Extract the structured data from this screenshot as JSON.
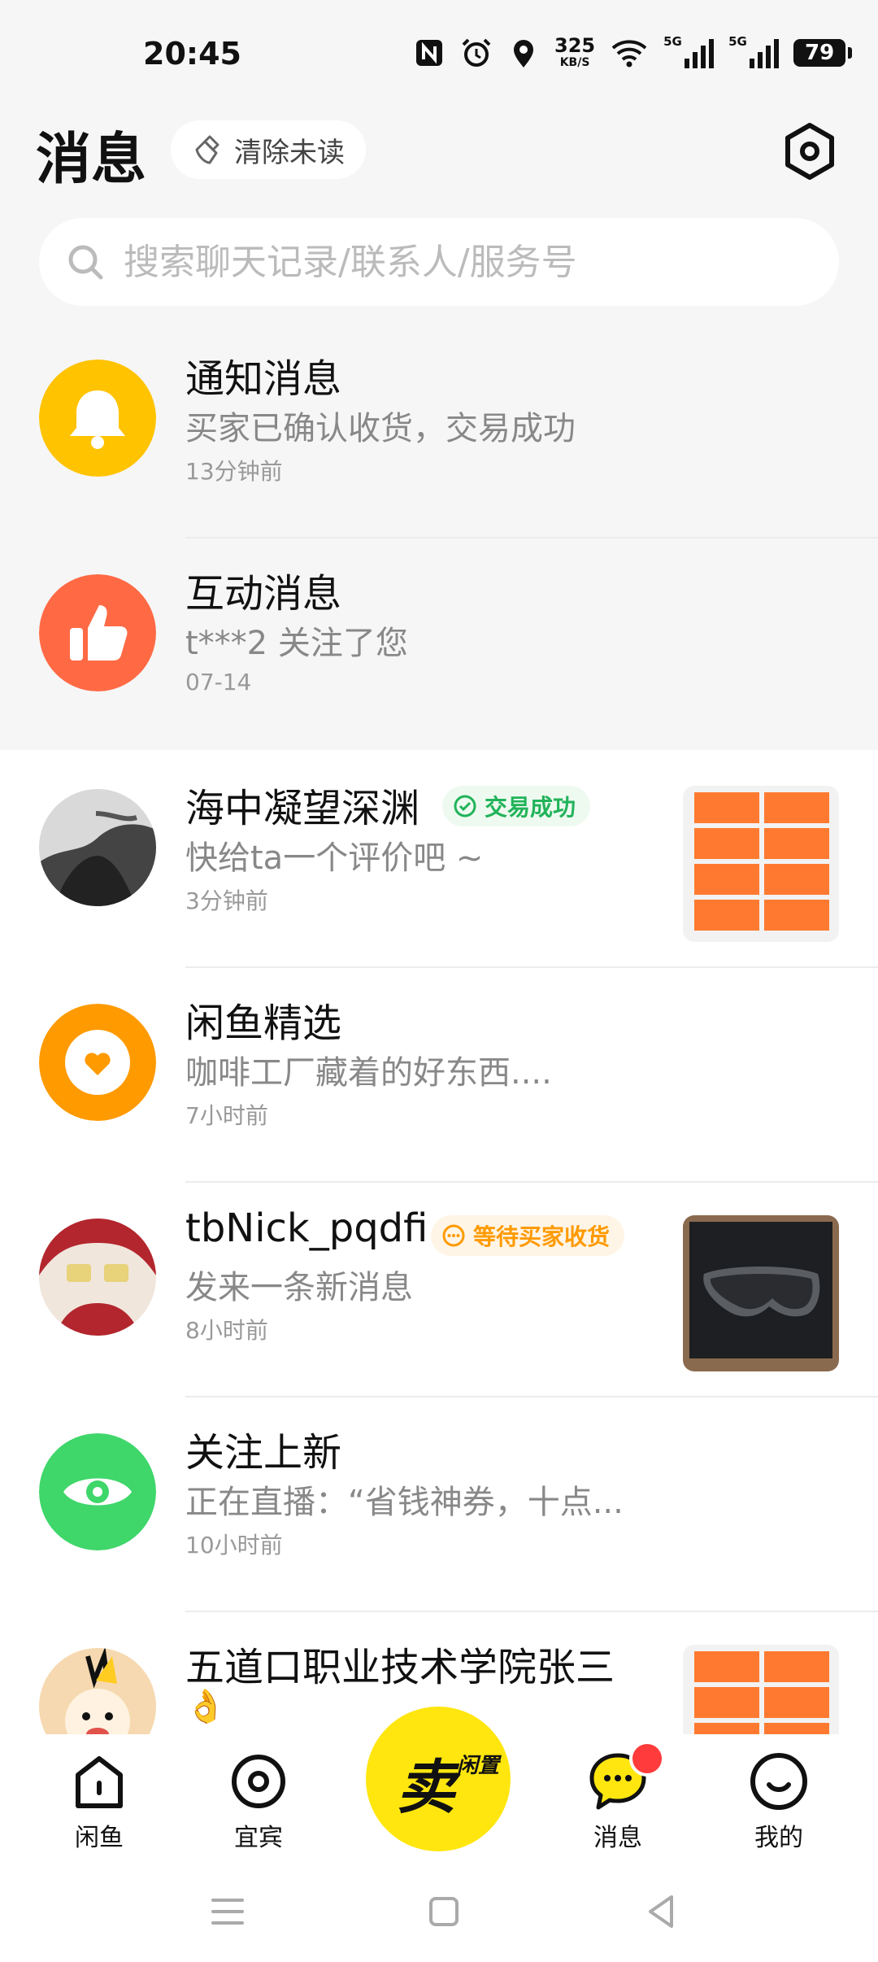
{
  "status_bar": {
    "time": "20:45",
    "net_speed_value": "325",
    "net_speed_unit": "KB/S",
    "signal_1": "5G",
    "signal_2": "5G",
    "battery": "79",
    "icons": [
      "nfc-icon",
      "alarm-icon",
      "location-icon",
      "wifi-icon",
      "signal-icon",
      "battery-icon"
    ]
  },
  "header": {
    "title": "消息",
    "clear_unread": "清除未读"
  },
  "search": {
    "placeholder": "搜索聊天记录/联系人/服务号"
  },
  "conversations": [
    {
      "title": "通知消息",
      "subtitle": "买家已确认收货，交易成功",
      "time": "13分钟前",
      "icon": "bell-icon",
      "color": "#ffc300"
    },
    {
      "title": "互动消息",
      "subtitle": "t***2 关注了您",
      "time": "07-14",
      "icon": "thumbs-up-icon",
      "color": "#ff6a45"
    },
    {
      "title": "海中凝望深渊",
      "badge": "交易成功",
      "subtitle": "快给ta一个评价吧 ~",
      "time": "3分钟前"
    },
    {
      "title": "闲鱼精选",
      "subtitle": "咖啡工厂藏着的好东西....",
      "time": "7小时前",
      "icon": "heart-icon",
      "color": "#ff9a00"
    },
    {
      "title": "tbNick_pqdfi",
      "badge": "等待买家收货",
      "subtitle": "发来一条新消息",
      "time": "8小时前"
    },
    {
      "title": "关注上新",
      "subtitle": "正在直播：“省钱神券，十点...",
      "time": "10小时前",
      "icon": "eye-icon",
      "color": "#3fd66a"
    },
    {
      "title": "五道口职业技术学院张三",
      "subtitle": "👌"
    }
  ],
  "bottom_nav": {
    "home": "闲鱼",
    "city": "宜宾",
    "sell_big": "卖",
    "sell_small": "闲置",
    "messages": "消息",
    "mine": "我的"
  },
  "colors": {
    "accent_yellow": "#ffe60f",
    "success_green": "#22b35a",
    "waiting_orange": "#ff9a00",
    "unread_red": "#ff3b3b"
  }
}
